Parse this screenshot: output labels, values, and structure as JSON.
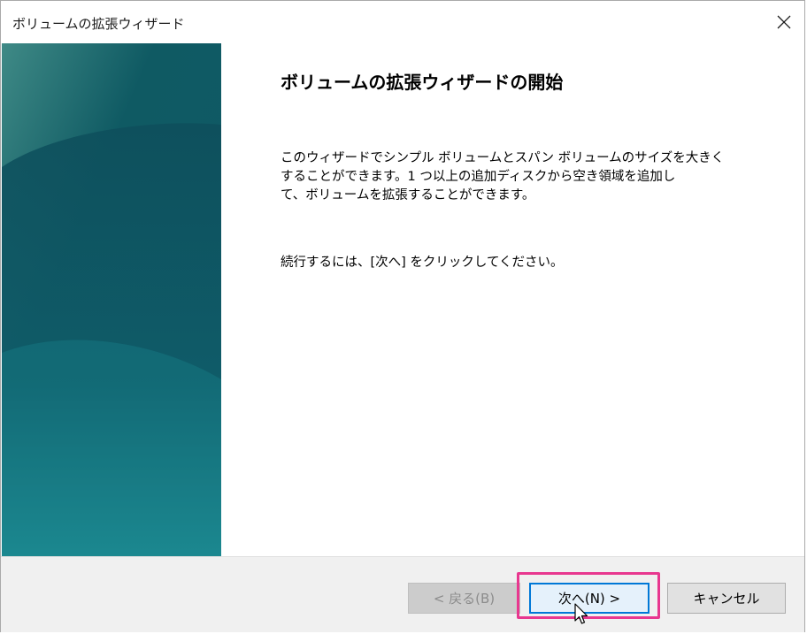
{
  "window": {
    "title": "ボリュームの拡張ウィザード"
  },
  "content": {
    "heading": "ボリュームの拡張ウィザードの開始",
    "description_lines": [
      "このウィザードでシンプル ボリュームとスパン ボリュームのサイズを大きく",
      "することができます。1 つ以上の追加ディスクから空き領域を追加し",
      "て、ボリュームを拡張することができます。"
    ],
    "instruction": "続行するには、[次へ] をクリックしてください。"
  },
  "buttons": {
    "back_label": "< 戻る(B)",
    "next_label": "次へ(N) >",
    "cancel_label": "キャンセル"
  },
  "icons": {
    "close": "close-icon",
    "cursor": "mouse-pointer-icon"
  },
  "colors": {
    "panel_dark": "#0d4a57",
    "panel_light": "#1a8a93",
    "highlight": "#e8378f",
    "focus": "#0078d7"
  }
}
